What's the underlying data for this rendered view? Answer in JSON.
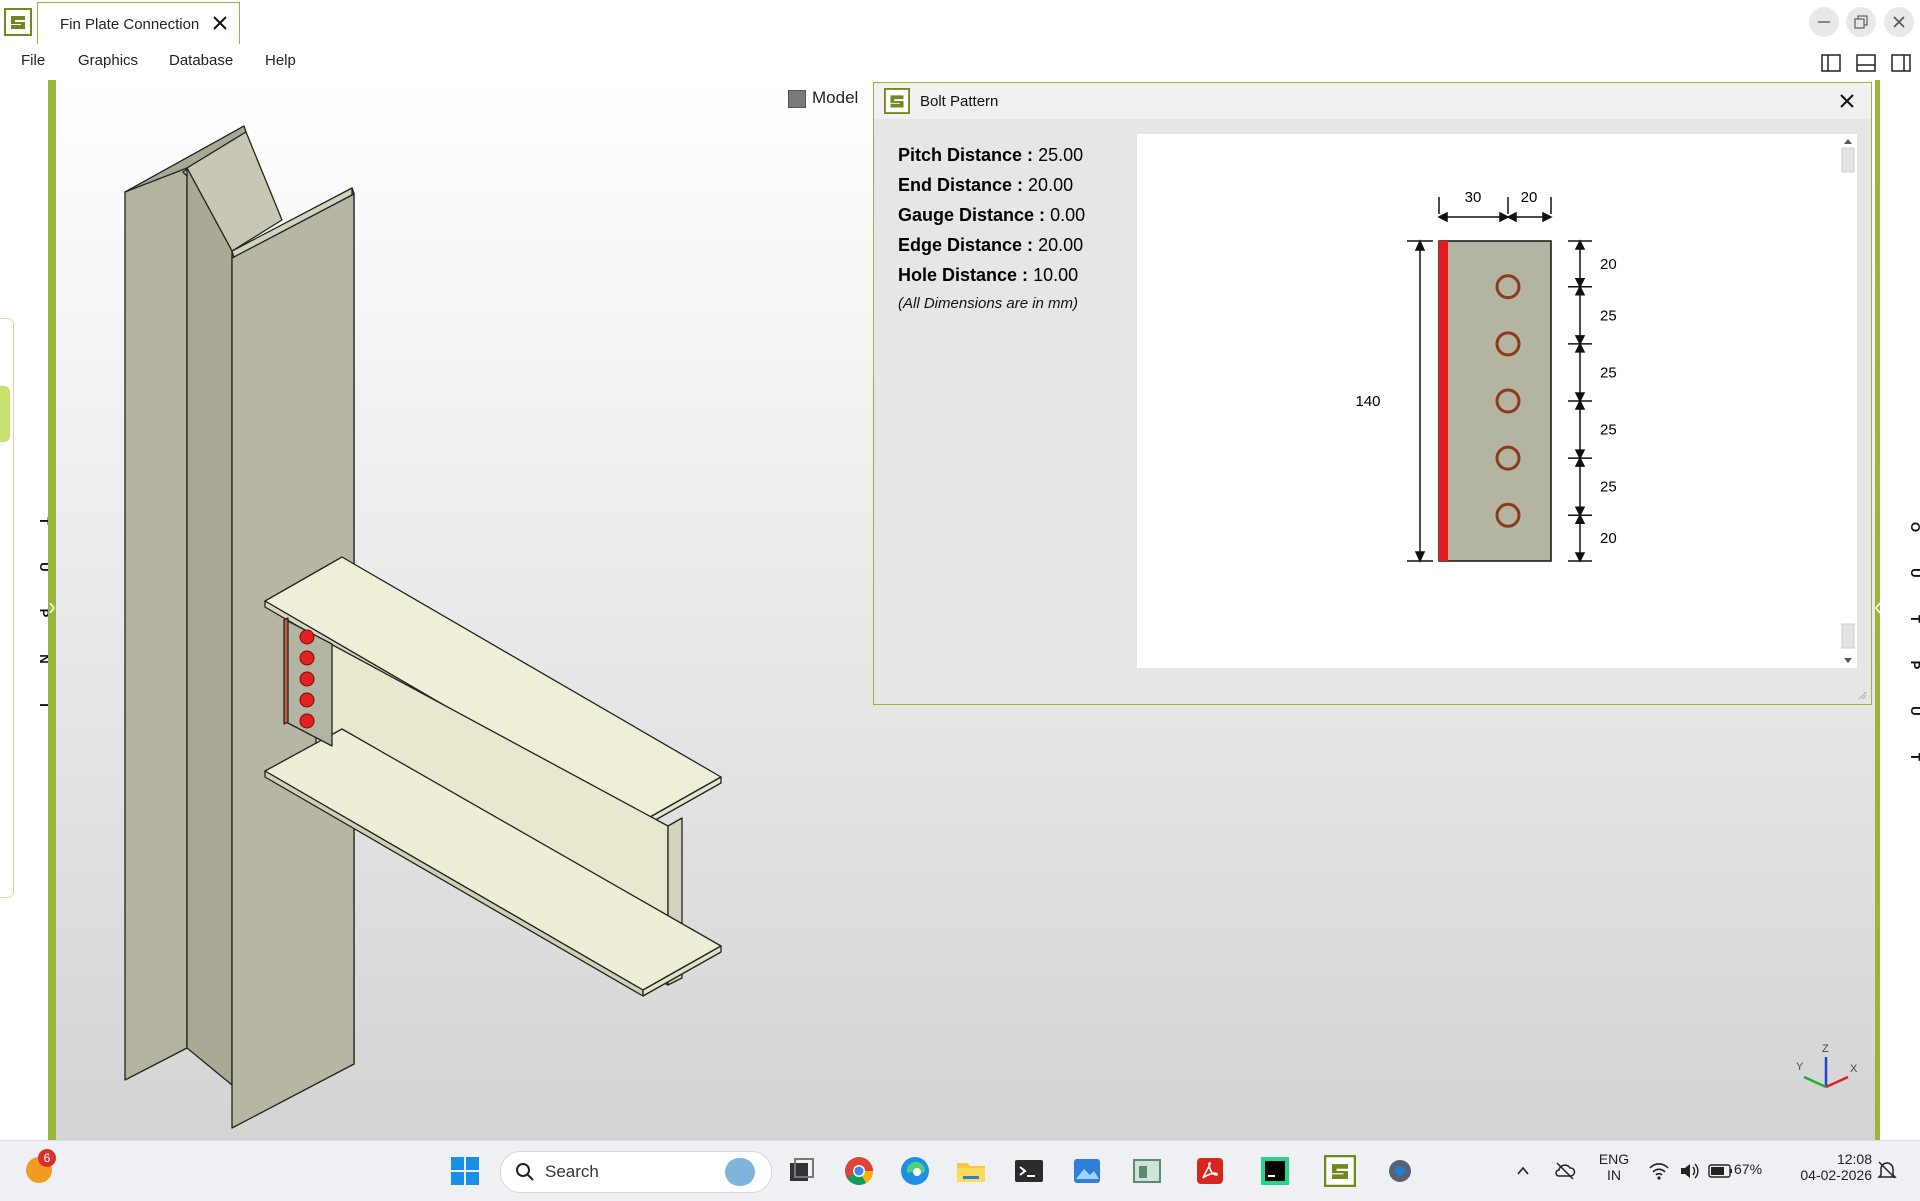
{
  "window": {
    "tab_title": "Fin Plate Connection"
  },
  "menu": {
    "items": [
      "File",
      "Graphics",
      "Database",
      "Help"
    ]
  },
  "docks": {
    "input_letters": [
      "I",
      "N",
      "P",
      "U",
      "T"
    ],
    "output_letters": [
      "O",
      "U",
      "T",
      "P",
      "U",
      "T"
    ]
  },
  "viewport": {
    "model_label": "Model",
    "axis_labels": {
      "x": "X",
      "y": "Y",
      "z": "Z"
    }
  },
  "bolt_dialog": {
    "title": "Bolt Pattern",
    "params": [
      {
        "label": "Pitch Distance :",
        "value": "25.00"
      },
      {
        "label": "End Distance :",
        "value": "20.00"
      },
      {
        "label": "Gauge Distance :",
        "value": "0.00"
      },
      {
        "label": "Edge Distance :",
        "value": "20.00"
      },
      {
        "label": "Hole Distance :",
        "value": "10.00"
      }
    ],
    "units_note": "(All Dimensions are in mm)",
    "drawing": {
      "top_dims": [
        "30",
        "20"
      ],
      "height_dim": "140",
      "right_dims": [
        "20",
        "25",
        "25",
        "25",
        "25",
        "20"
      ],
      "bolt_count": 5,
      "plate_color": "#b4b4a2",
      "edge_color": "#e41b1b",
      "hole_color": "#8b3a1a"
    }
  },
  "taskbar": {
    "badge_count": "6",
    "search_placeholder": "Search",
    "lang_line1": "ENG",
    "lang_line2": "IN",
    "battery": "67%",
    "time": "12:08",
    "date": "04-02-2026"
  },
  "colors": {
    "accent": "#9ab53c",
    "steel": "#b4b4a2",
    "beam": "#ececd4"
  }
}
